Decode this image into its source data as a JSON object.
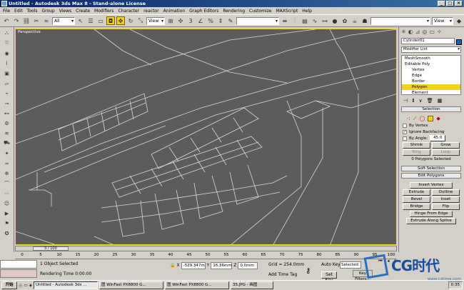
{
  "window": {
    "title": "Untitled - Autodesk 3ds Max 8 - Stand-alone License"
  },
  "menu": [
    "File",
    "Edit",
    "Tools",
    "Group",
    "Views",
    "Create",
    "Modifiers",
    "Character",
    "reactor",
    "Animation",
    "Graph Editors",
    "Rendering",
    "Customize",
    "MAXScript",
    "Help"
  ],
  "toolbar": {
    "filter": "All",
    "ref_coord": "View",
    "named_sel": "",
    "view_right": "View"
  },
  "viewport": {
    "label": "Perspective"
  },
  "timeline": {
    "slider": "0 / 100"
  },
  "ruler": [
    "0",
    "5",
    "10",
    "15",
    "20",
    "25",
    "30",
    "35",
    "40",
    "45",
    "50",
    "55",
    "60",
    "65",
    "70",
    "75",
    "80",
    "85",
    "90",
    "95",
    "100"
  ],
  "status": {
    "selected": "1 Object Selected",
    "render_time": "Rendering Time  0:00:00",
    "x": "-529.347m",
    "y": "16.36mm",
    "z": "0.0mm",
    "grid": "Grid = 254.0mm",
    "add_time_tag": "Add Time Tag",
    "auto_key": "Auto Key",
    "set_key": "Set Key",
    "selected_dd": "Selected",
    "key_filters": "Key Filters..."
  },
  "panel": {
    "object_name": "Cylinder01",
    "modifier_list": "Modifier List",
    "stack": [
      "MeshSmooth",
      "Editable Poly",
      "Vertex",
      "Edge",
      "Border",
      "Polygon",
      "Element"
    ],
    "selection": {
      "title": "Selection",
      "by_vertex": "By Vertex",
      "ignore_backfacing": "Ignore Backfacing",
      "by_angle": "By Angle:",
      "angle_value": "45.0",
      "shrink": "Shrink",
      "grow": "Grow",
      "ring": "Ring",
      "loop": "Loop",
      "status": "0 Polygons Selected"
    },
    "soft_selection": "Soft Selection",
    "edit_polygons": {
      "title": "Edit Polygons",
      "insert_vertex": "Insert Vertex",
      "extrude": "Extrude",
      "outline": "Outline",
      "bevel": "Bevel",
      "inset": "Inset",
      "bridge": "Bridge",
      "flip": "Flip",
      "hinge": "Hinge From Edge",
      "extrude_spline": "Extrude Along Spline"
    }
  },
  "taskbar": {
    "start": "开始",
    "tasks": [
      "Untitled - Autodesk 3ds ...",
      "图 WinFast PX8800 G...",
      "图 WinFast PX8800 G...",
      "35.JPG - 画图"
    ],
    "clock": "0:35"
  },
  "watermark": {
    "brand": "CG时代",
    "url": "www.cgtime.com"
  }
}
